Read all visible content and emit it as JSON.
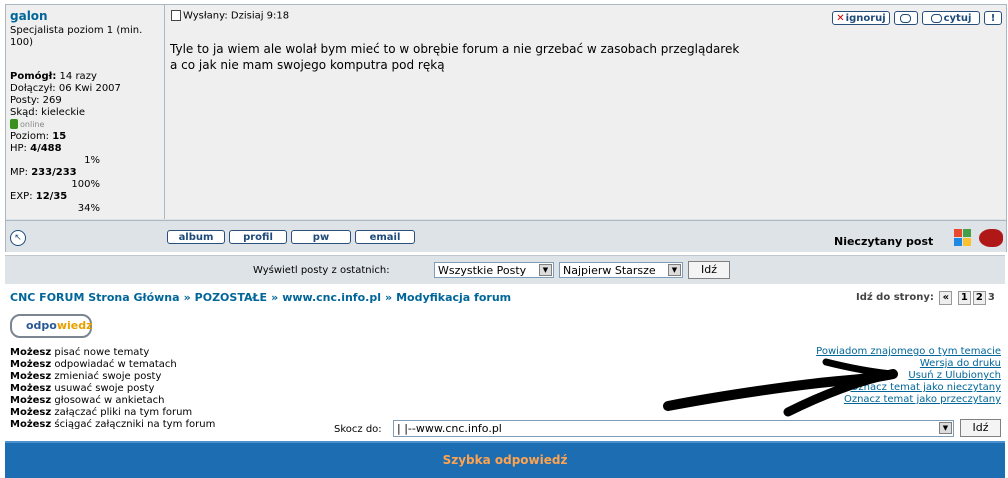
{
  "post": {
    "author": "galon",
    "rank": "Specjalista poziom 1 (min. 100)",
    "stats": {
      "helped_label": "Pomógł:",
      "helped_value": "14 razy",
      "joined_label": "Dołączył:",
      "joined_value": "06 Kwi 2007",
      "posts_label": "Posty:",
      "posts_value": "269",
      "from_label": "Skąd:",
      "from_value": "kieleckie",
      "online_text": "online",
      "level_label": "Poziom:",
      "level_value": "15",
      "hp_label": "HP:",
      "hp_value": "4/488",
      "hp_pct": "1%",
      "mp_label": "MP:",
      "mp_value": "233/233",
      "mp_pct": "100%",
      "exp_label": "EXP:",
      "exp_value": "12/35",
      "exp_pct": "34%"
    },
    "posted_label": "Wysłany: Dzisiaj 9:18",
    "body_lines": [
      "Tyle to ja wiem ale wolał bym mieć to w obrębie forum a nie grzebać w zasobach przeglądarek",
      "a co jak nie mam swojego komputra pod ręką"
    ],
    "actions": {
      "ignore": "ignoruj",
      "quote": "cytuj",
      "report": "!"
    },
    "bottom_buttons": {
      "album": "album",
      "profile": "profil",
      "pm": "pw",
      "email": "email"
    },
    "unread": "Nieczytany post"
  },
  "filter": {
    "label": "Wyświetl posty z ostatnich:",
    "range": "Wszystkie Posty",
    "order": "Najpierw Starsze",
    "go": "Idź"
  },
  "breadcrumb": [
    "CNC FORUM Strona Główna",
    "POZOSTAŁE",
    "www.cnc.info.pl",
    "Modyfikacja forum"
  ],
  "breadcrumb_sep": "»",
  "pagination": {
    "label": "Idź do strony:",
    "prev": "«",
    "pages": [
      "1",
      "2",
      "3"
    ]
  },
  "reply_button": {
    "part1": "odpo",
    "part2": "wiedz"
  },
  "permissions": {
    "word": "Możesz",
    "items": [
      "pisać nowe tematy",
      "odpowiadać w tematach",
      "zmieniać swoje posty",
      "usuwać swoje posty",
      "głosować w ankietach",
      "załączać pliki na tym forum",
      "ściągać załączniki na tym forum"
    ]
  },
  "topic_links": [
    "Powiadom znajomego o tym temacie",
    "Wersja do druku",
    "Usuń z Ulubionych",
    "Oznacz temat jako nieczytany",
    "Oznacz temat jako przeczytany"
  ],
  "jump": {
    "label": "Skocz do:",
    "value": "|   |--www.cnc.info.pl",
    "go": "Idź"
  },
  "quick_reply": "Szybka odpowiedź",
  "colors": {
    "link": "#006699",
    "bar": "#1d6db3",
    "bar_text": "#ffa34f",
    "panel": "#efefef",
    "border": "#a9b8c2"
  }
}
